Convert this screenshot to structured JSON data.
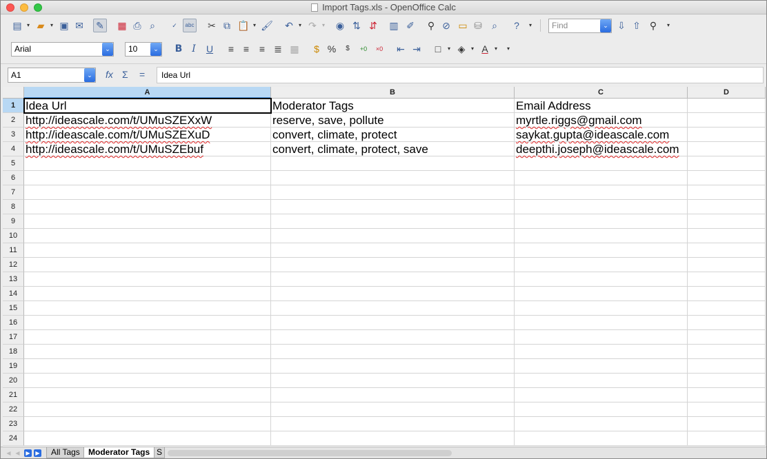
{
  "window": {
    "title": "Import Tags.xls - OpenOffice Calc"
  },
  "toolbar_standard": {
    "find_placeholder": "Find"
  },
  "toolbar_format": {
    "font_name": "Arial",
    "font_size": "10",
    "bold": "B",
    "italic": "I",
    "underline": "U",
    "percent": "%"
  },
  "formula_bar": {
    "name_box": "A1",
    "content": "Idea Url"
  },
  "sheet": {
    "columns": [
      "A",
      "B",
      "C",
      "D"
    ],
    "rows": [
      "1",
      "2",
      "3",
      "4",
      "5",
      "6",
      "7",
      "8",
      "9",
      "10",
      "11",
      "12",
      "13",
      "14",
      "15",
      "16",
      "17",
      "18",
      "19",
      "20",
      "21",
      "22",
      "23",
      "24"
    ],
    "cells": {
      "A1": "Idea Url",
      "B1": "Moderator Tags",
      "C1": "Email Address",
      "A2": "http://ideascale.com/t/UMuSZEXxW",
      "B2": "reserve, save, pollute",
      "C2": "myrtle.riggs@gmail.com",
      "A3": "http://ideascale.com/t/UMuSZEXuD",
      "B3": "convert, climate, protect",
      "C3": "saykat.gupta@ideascale.com",
      "A4": "http://ideascale.com/t/UMuSZEbuf",
      "B4": "convert, climate, protect, save",
      "C4": "deepthi.joseph@ideascale.com"
    }
  },
  "tabs": [
    {
      "label": "All Tags"
    },
    {
      "label": "Moderator Tags"
    },
    {
      "label": "S"
    }
  ],
  "colors": {
    "accent": "#2a6ce0",
    "selected_header": "#b8d8f4",
    "spell_error": "#dd2222"
  }
}
